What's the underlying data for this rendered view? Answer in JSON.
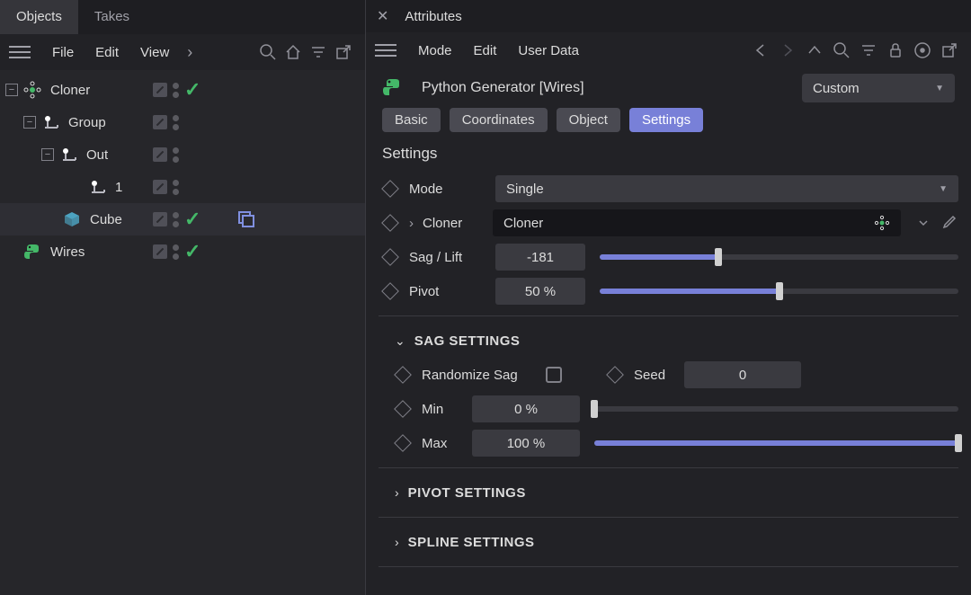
{
  "left": {
    "tabs": [
      "Objects",
      "Takes"
    ],
    "menu": [
      "File",
      "Edit",
      "View"
    ],
    "tree": {
      "cloner": "Cloner",
      "group": "Group",
      "out": "Out",
      "one": "1",
      "cube": "Cube",
      "wires": "Wires"
    }
  },
  "right": {
    "panel_title": "Attributes",
    "menu": [
      "Mode",
      "Edit",
      "User Data"
    ],
    "object_title": "Python Generator [Wires]",
    "layout_mode": "Custom",
    "tabs": [
      "Basic",
      "Coordinates",
      "Object",
      "Settings"
    ],
    "section": "Settings",
    "mode": {
      "label": "Mode",
      "value": "Single"
    },
    "cloner": {
      "label": "Cloner",
      "value": "Cloner"
    },
    "sag": {
      "label": "Sag / Lift",
      "value": "-181",
      "pct": 33
    },
    "pivot": {
      "label": "Pivot",
      "value": "50 %",
      "pct": 50
    },
    "group_sag": "SAG SETTINGS",
    "randomize": {
      "label": "Randomize Sag"
    },
    "seed": {
      "label": "Seed",
      "value": "0"
    },
    "min": {
      "label": "Min",
      "value": "0 %",
      "pct": 0
    },
    "max": {
      "label": "Max",
      "value": "100 %",
      "pct": 100
    },
    "group_pivot": "PIVOT SETTINGS",
    "group_spline": "SPLINE SETTINGS"
  }
}
